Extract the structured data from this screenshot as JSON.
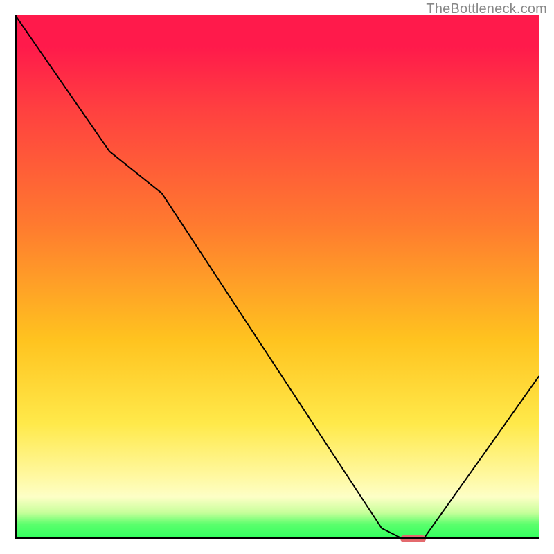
{
  "watermark": "TheBottleneck.com",
  "chart_data": {
    "type": "line",
    "title": "",
    "xlabel": "",
    "ylabel": "",
    "xlim": [
      0,
      100
    ],
    "ylim": [
      0,
      100
    ],
    "x": [
      0,
      18,
      28,
      70,
      74,
      78,
      100
    ],
    "values": [
      100,
      74,
      66,
      2,
      0,
      0,
      31
    ],
    "gradient_stops": [
      {
        "pos": 0,
        "color": "#ff1a4b"
      },
      {
        "pos": 6,
        "color": "#ff1a4b"
      },
      {
        "pos": 18,
        "color": "#ff4040"
      },
      {
        "pos": 40,
        "color": "#ff7a2f"
      },
      {
        "pos": 62,
        "color": "#ffc31f"
      },
      {
        "pos": 78,
        "color": "#ffe94a"
      },
      {
        "pos": 88,
        "color": "#fff8a0"
      },
      {
        "pos": 92,
        "color": "#fdffc6"
      },
      {
        "pos": 95,
        "color": "#c8ff9b"
      },
      {
        "pos": 97.2,
        "color": "#5cff6d"
      },
      {
        "pos": 100,
        "color": "#2fff5e"
      }
    ],
    "marker": {
      "x": 76,
      "y": 0,
      "width_pct": 5,
      "color": "#e46a6e"
    }
  }
}
